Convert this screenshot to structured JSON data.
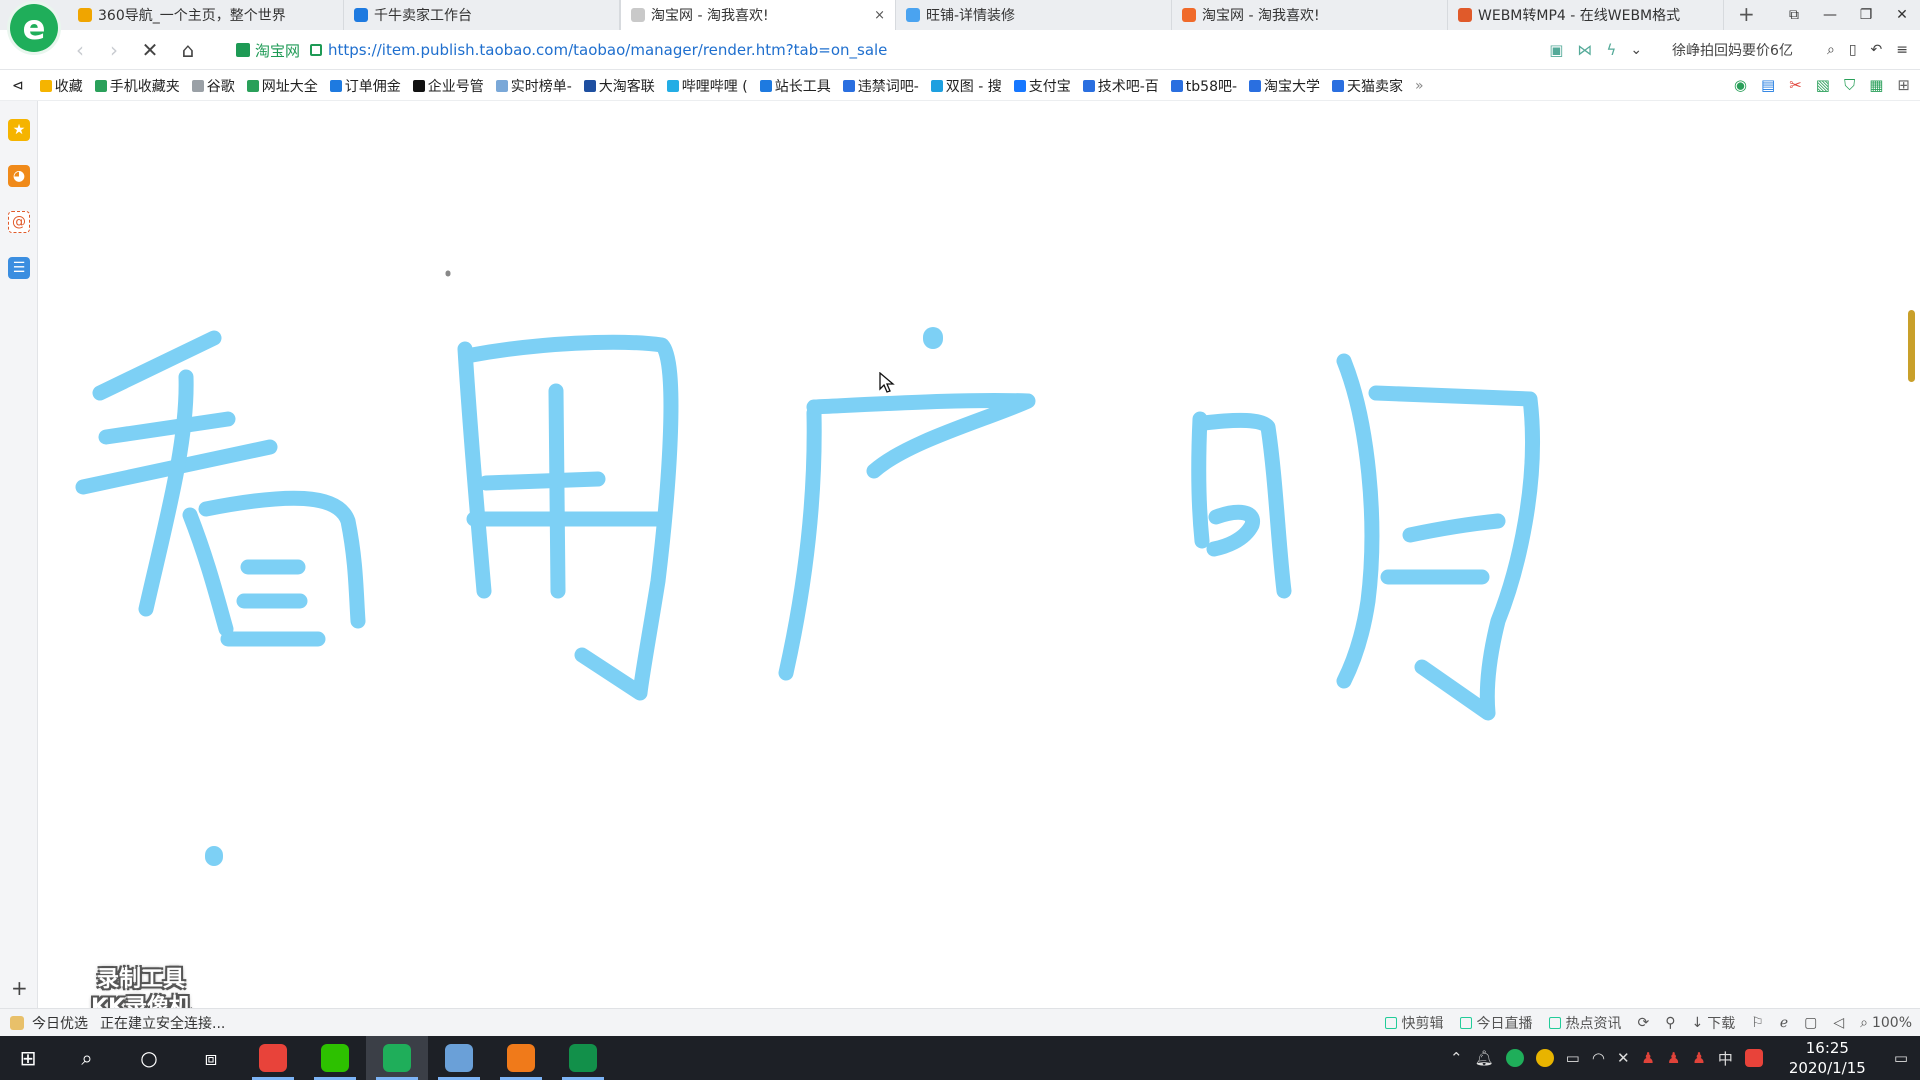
{
  "browser": {
    "logo_letter": "e",
    "tabs": [
      {
        "title": "360导航_一个主页，整个世界",
        "color": "#f0a500",
        "active": false
      },
      {
        "title": "千牛卖家工作台",
        "color": "#1e7ae0",
        "active": false
      },
      {
        "title": "淘宝网 - 淘我喜欢!",
        "color": "#c9c9c9",
        "active": true
      },
      {
        "title": "旺铺-详情装修",
        "color": "#4aa3f0",
        "active": false
      },
      {
        "title": "淘宝网 - 淘我喜欢!",
        "color": "#f06a2a",
        "active": false
      },
      {
        "title": "WEBM转MP4 - 在线WEBM格式",
        "color": "#e05a2a",
        "active": false
      }
    ],
    "tab_close": "×",
    "new_tab": "+",
    "window_controls": [
      "⧉",
      "—",
      "❐",
      "✕"
    ],
    "address": {
      "site_label": "淘宝网",
      "url": "https://item.publish.taobao.com/taobao/manager/render.htm?tab=on_sale",
      "search_tip": "徐峥拍回妈要价6亿"
    },
    "bookmarks": [
      {
        "label": "收藏",
        "color": "#f5b400"
      },
      {
        "label": "手机收藏夹",
        "color": "#2aa05a"
      },
      {
        "label": "谷歌",
        "color": "#9aa0a6"
      },
      {
        "label": "网址大全",
        "color": "#2aa05a"
      },
      {
        "label": "订单佣金",
        "color": "#1e7ae0"
      },
      {
        "label": "企业号管",
        "color": "#111111"
      },
      {
        "label": "实时榜单-",
        "color": "#7aa8d8"
      },
      {
        "label": "大淘客联",
        "color": "#1e4fa0"
      },
      {
        "label": "哔哩哔哩 (",
        "color": "#23ade5"
      },
      {
        "label": "站长工具",
        "color": "#1e7ae0"
      },
      {
        "label": "违禁词吧-",
        "color": "#2a6fe0"
      },
      {
        "label": "双图 - 搜",
        "color": "#1ea0e0"
      },
      {
        "label": "支付宝",
        "color": "#1677ff"
      },
      {
        "label": "技术吧-百",
        "color": "#2a6fe0"
      },
      {
        "label": "tb58吧-",
        "color": "#2a6fe0"
      },
      {
        "label": "淘宝大学",
        "color": "#2a6fe0"
      },
      {
        "label": "天猫卖家",
        "color": "#2a6fe0"
      }
    ],
    "bookmarks_more": "»"
  },
  "content": {
    "watermark_line1": "录制工具",
    "watermark_line2": "KK录像机",
    "stroke_color": "#7dd0f5"
  },
  "statusbar": {
    "left_item": "今日优选",
    "status_text": "正在建立安全连接...",
    "right_items": [
      "快剪辑",
      "今日直播",
      "热点资讯",
      "下载"
    ],
    "zoom": "100%"
  },
  "taskbar": {
    "apps": [
      {
        "name": "red-app",
        "color": "#e8433a"
      },
      {
        "name": "wechat",
        "color": "#2dc100"
      },
      {
        "name": "360-browser",
        "color": "#1fae5a"
      },
      {
        "name": "notepad",
        "color": "#6aa0d8"
      },
      {
        "name": "orange-app",
        "color": "#f07a1a"
      },
      {
        "name": "green-app",
        "color": "#12904a"
      }
    ],
    "time": "16:25",
    "date": "2020/1/15",
    "ime": "中"
  }
}
